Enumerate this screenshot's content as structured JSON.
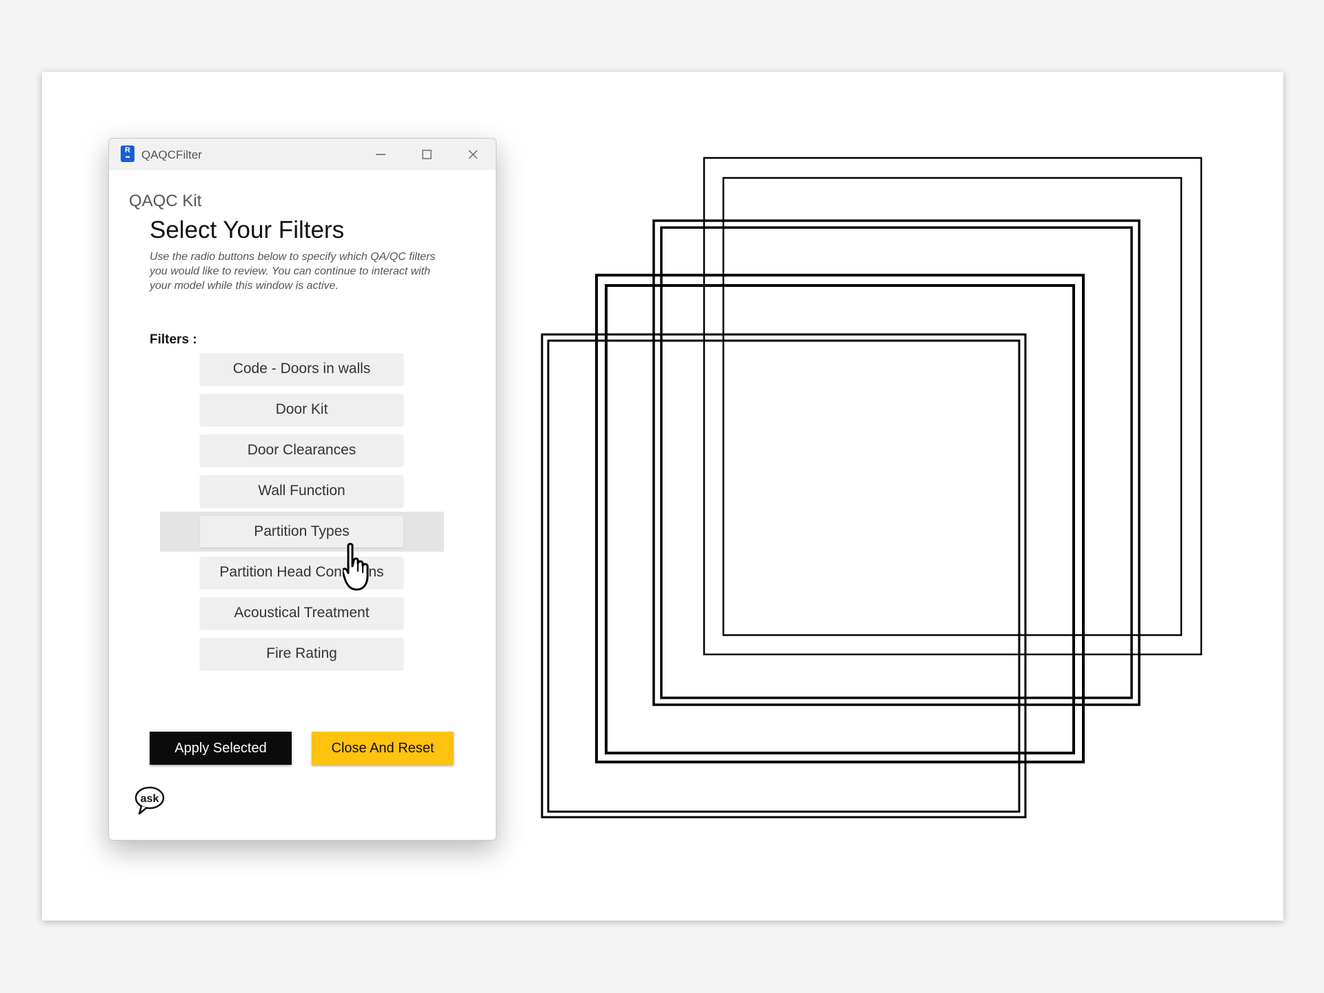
{
  "window": {
    "title": "QAQCFilter",
    "minimize_icon": "minimize-icon",
    "maximize_icon": "maximize-icon",
    "close_icon": "close-icon"
  },
  "panel": {
    "kit_label": "QAQC Kit",
    "heading": "Select Your Filters",
    "description": "Use the radio buttons below to specify which QA/QC filters you would like to review. You can continue to interact with your model while this window is active.",
    "filters_label": "Filters :"
  },
  "filters": [
    {
      "label": "Code - Doors in walls"
    },
    {
      "label": "Door Kit"
    },
    {
      "label": "Door Clearances"
    },
    {
      "label": "Wall Function"
    },
    {
      "label": "Partition Types",
      "hovered": true
    },
    {
      "label": "Partition Head Conditions"
    },
    {
      "label": "Acoustical Treatment"
    },
    {
      "label": "Fire Rating"
    }
  ],
  "actions": {
    "apply_label": "Apply Selected",
    "close_label": "Close And Reset"
  },
  "ask_icon_text": "ask",
  "colors": {
    "accent_yellow": "#ffc20e",
    "primary_black": "#0b0b0b",
    "app_icon_blue": "#1b5fd1"
  }
}
